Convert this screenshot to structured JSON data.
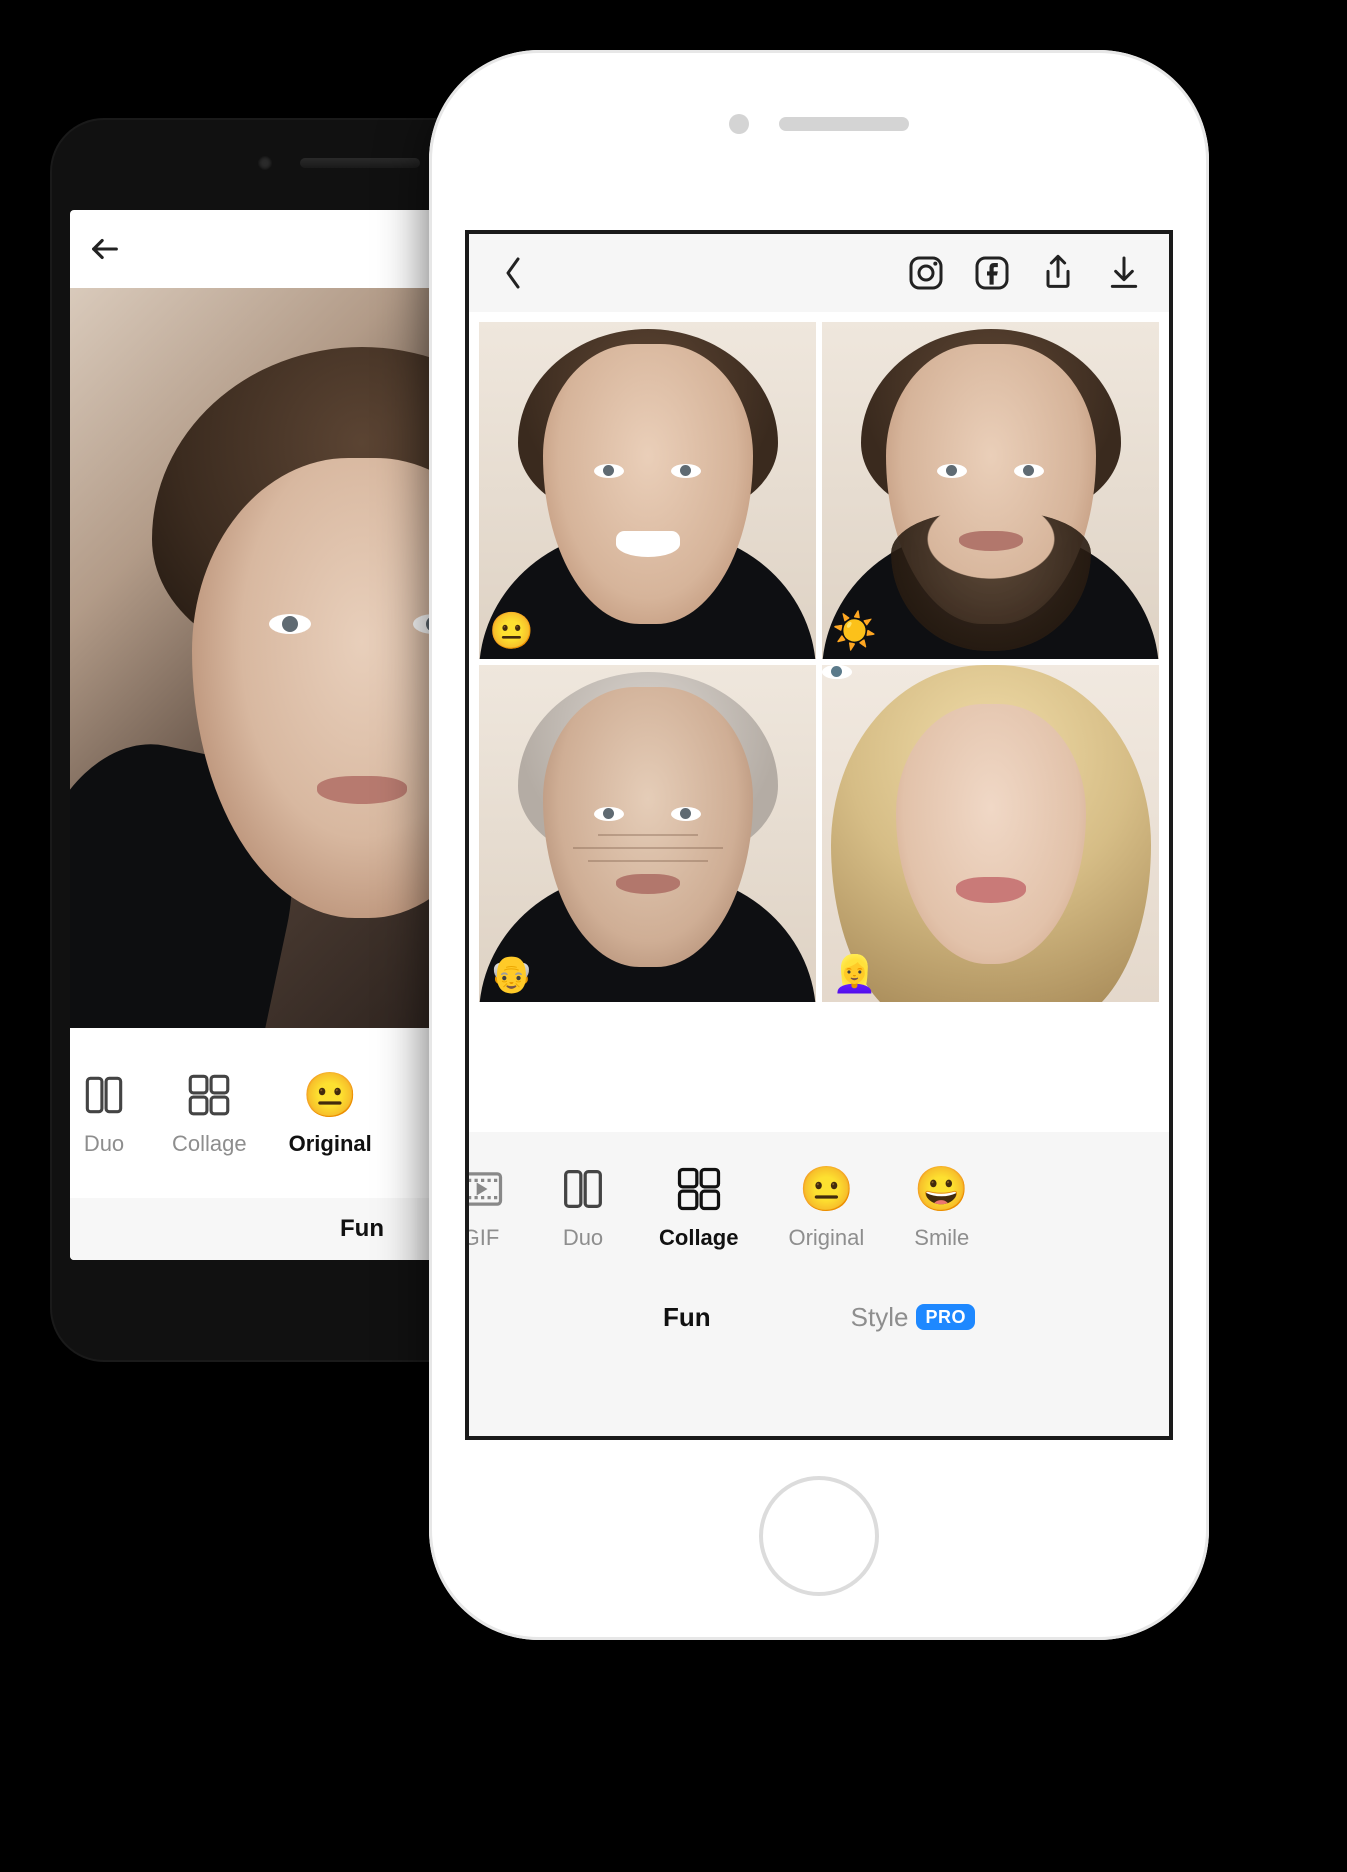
{
  "android": {
    "filters": {
      "duo": "Duo",
      "collage": "Collage",
      "original": "Original"
    },
    "tabs": {
      "fun": "Fun"
    }
  },
  "iphone": {
    "collage": {
      "badges": {
        "smile": "😐",
        "spark": "☀️",
        "old": "👴",
        "female": "👱‍♀️"
      }
    },
    "filters": {
      "gif": "GIF",
      "duo": "Duo",
      "collage": "Collage",
      "original": "Original",
      "smile": "Smile"
    },
    "tabs": {
      "fun": "Fun",
      "style": "Style",
      "pro_badge": "PRO"
    }
  }
}
